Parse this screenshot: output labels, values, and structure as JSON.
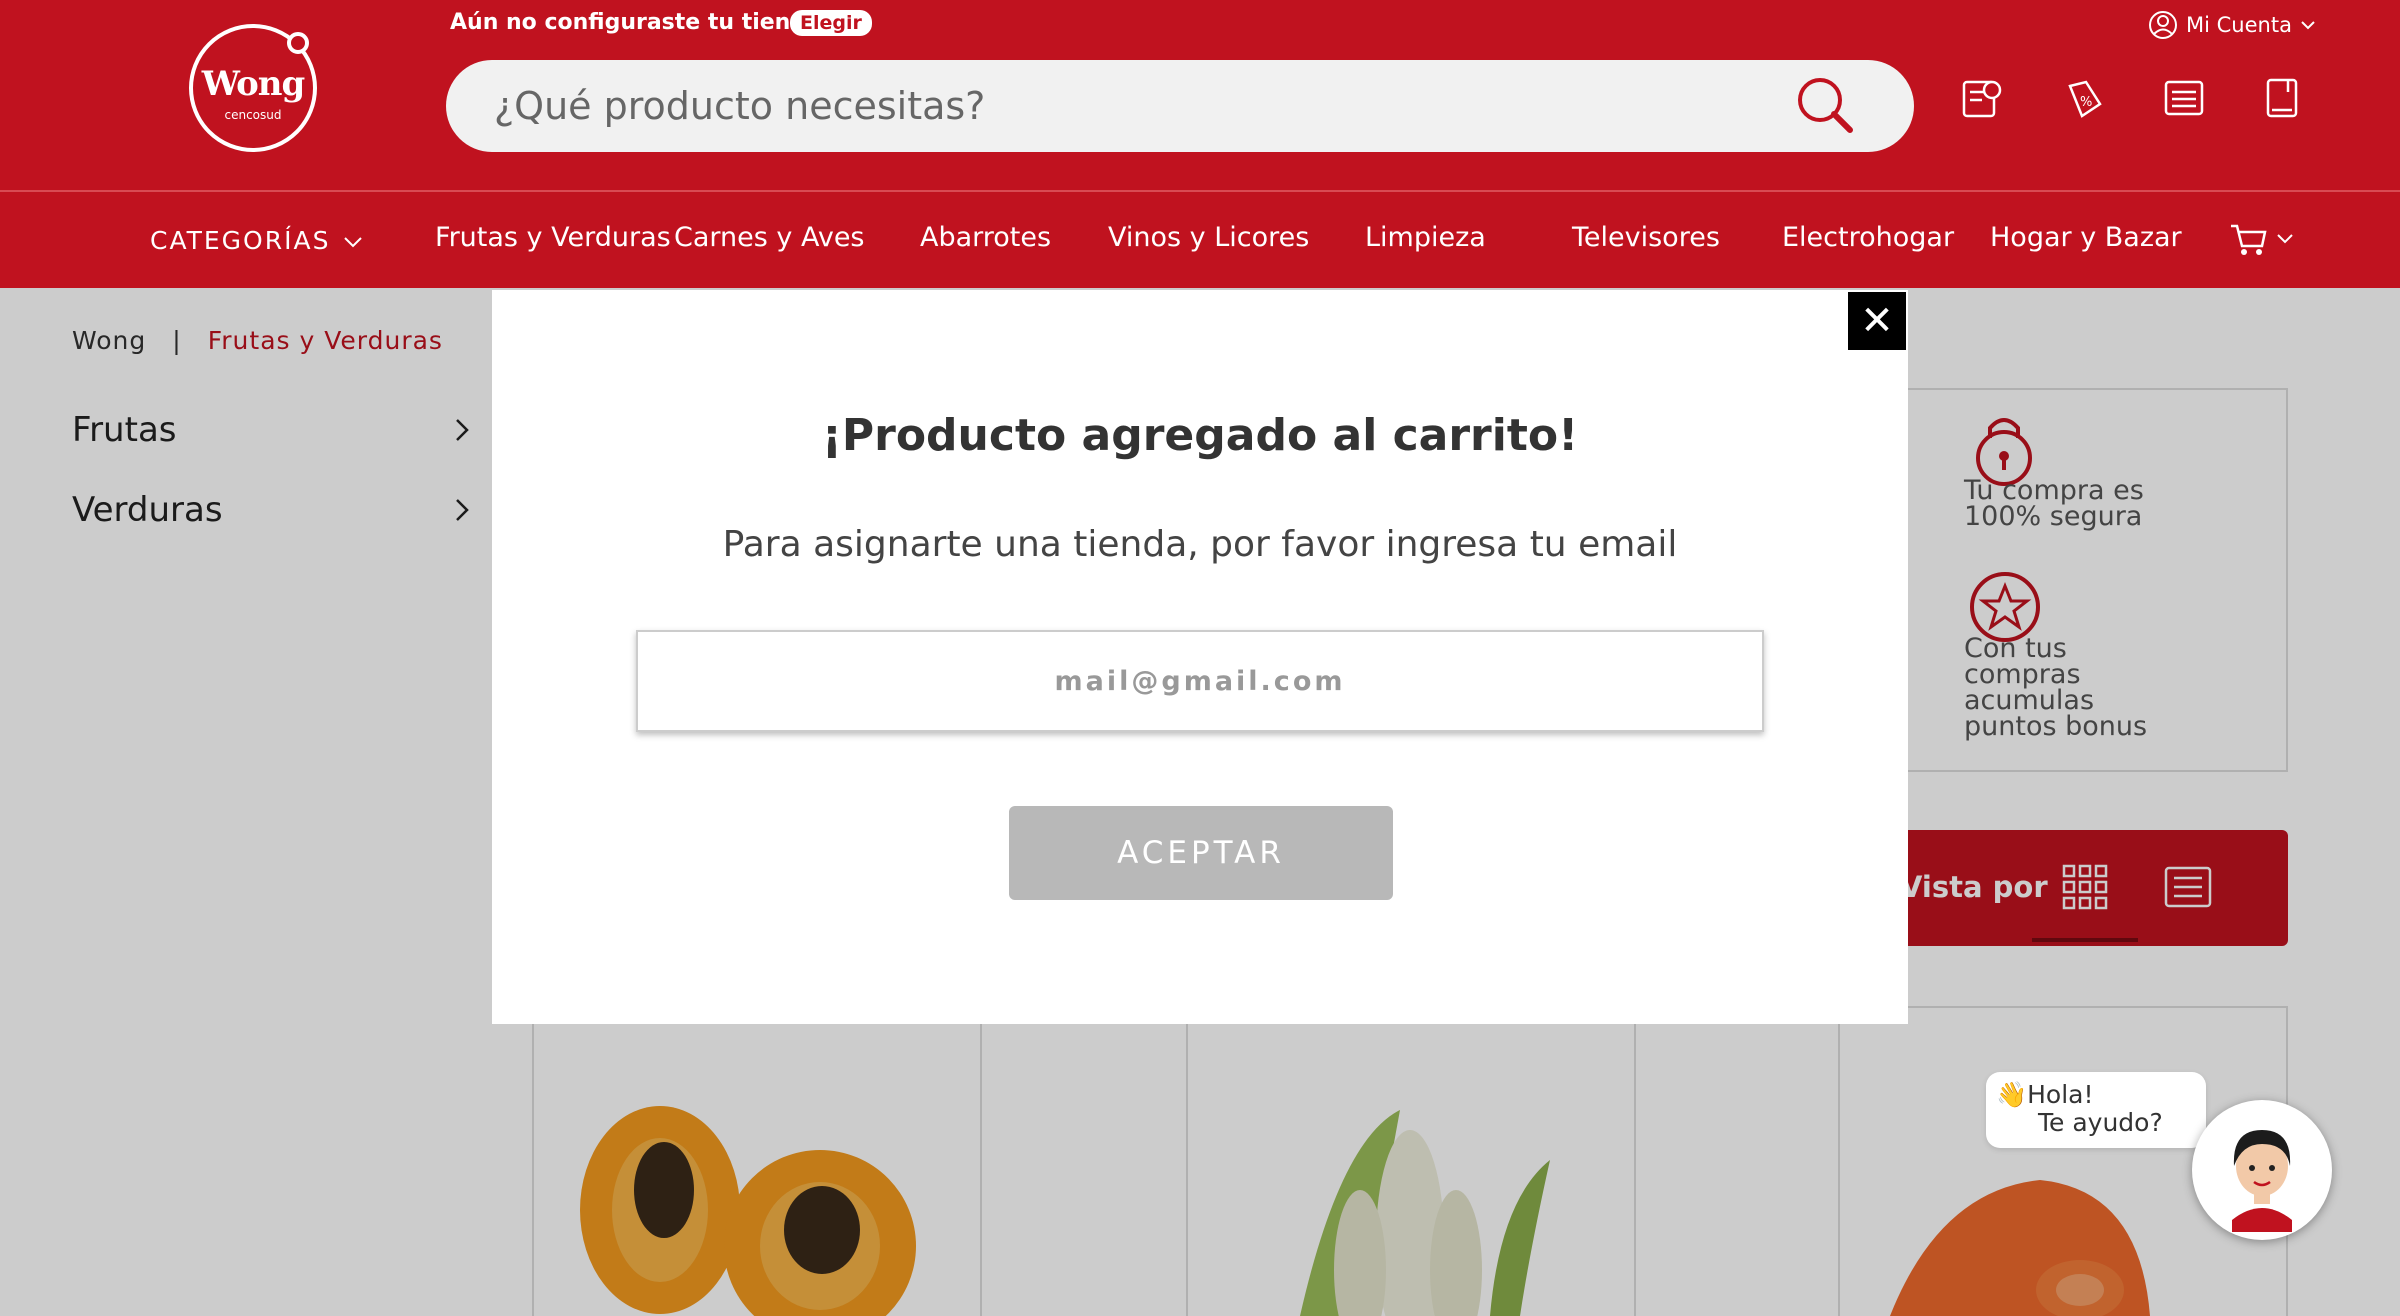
{
  "colors": {
    "brand": "#c0121f",
    "accent_dark": "#7a0a12",
    "button_disabled": "#b8b8b8"
  },
  "header": {
    "logo": {
      "name": "Wong",
      "sub": "cencosud"
    },
    "store_prompt": "Aún no configuraste tu tienda",
    "store_button": "Elegir",
    "search_placeholder": "¿Qué producto necesitas?",
    "account_label": "Mi Cuenta",
    "icons": [
      "quote-list-icon",
      "offers-tag-icon",
      "shopping-list-icon",
      "catalog-book-icon"
    ]
  },
  "nav": {
    "categories_label": "CATEGORÍAS",
    "items": [
      "Frutas y Verduras",
      "Carnes y Aves",
      "Abarrotes",
      "Vinos y Licores",
      "Limpieza",
      "Televisores",
      "Electrohogar",
      "Hogar y Bazar"
    ]
  },
  "breadcrumb": {
    "home": "Wong",
    "separator": "|",
    "current": "Frutas y Verduras"
  },
  "sidebar": {
    "items": [
      "Frutas",
      "Verduras"
    ]
  },
  "security": {
    "secure_purchase": "Tu compra es 100% segura",
    "bonus_points": "Con tus compras acumulas puntos bonus"
  },
  "toolbar": {
    "view_label": "Vista por"
  },
  "modal": {
    "title": "¡Producto agregado al carrito!",
    "subtitle": "Para asignarte una tienda, por favor ingresa tu email",
    "email_placeholder": "mail@gmail.com",
    "accept_label": "ACEPTAR",
    "close_symbol": "✕"
  },
  "chat": {
    "greeting": "👋Hola!",
    "help": "Te ayudo?"
  }
}
